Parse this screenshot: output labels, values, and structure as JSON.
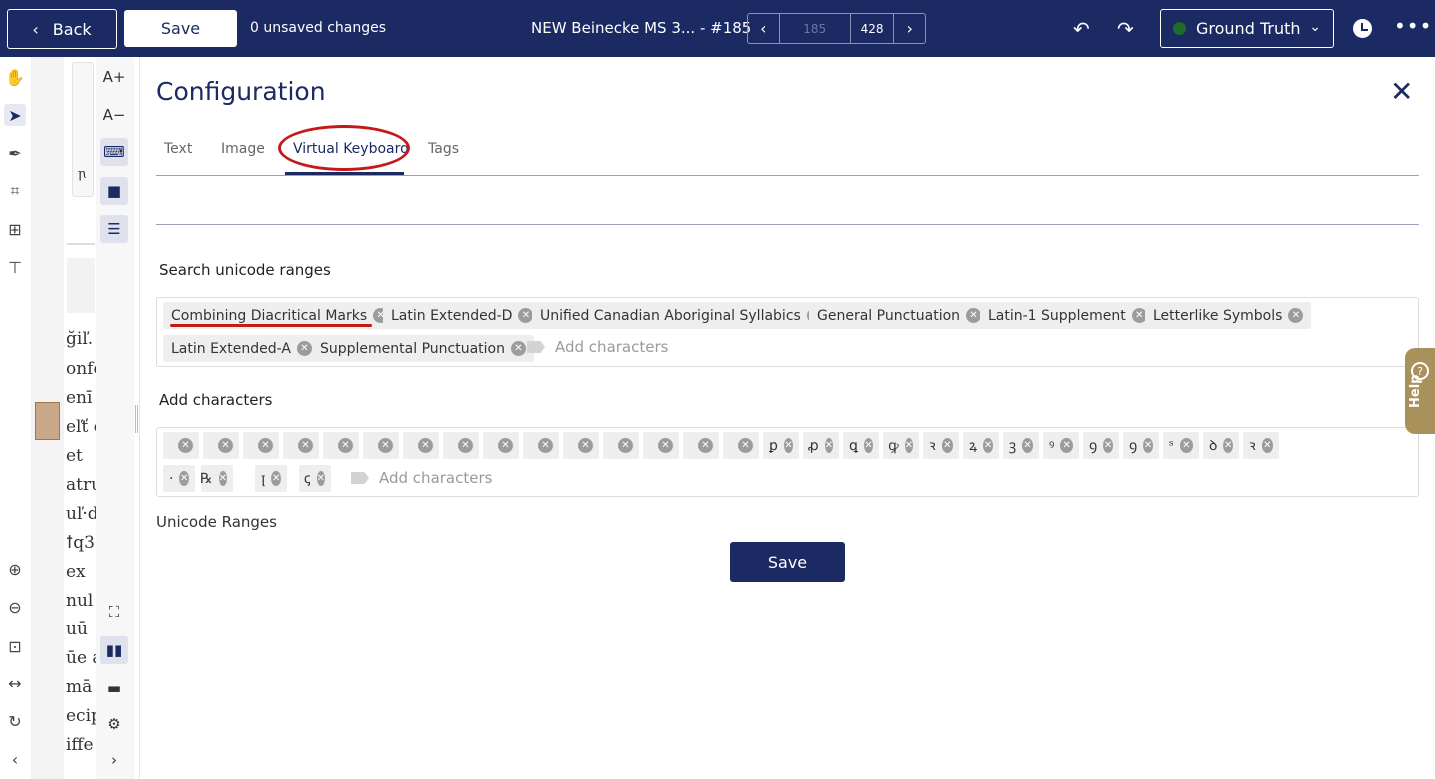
{
  "topbar": {
    "back_label": "Back",
    "save_label": "Save",
    "unsaved_text": "0 unsaved changes",
    "document_title": "NEW Beinecke MS 3... - #185",
    "pager_current": "185",
    "pager_total": "428",
    "transcription_select": "Ground Truth"
  },
  "left_text_fragments": [
    "ğiľ.",
    "onfe",
    "enī",
    "eľť c",
    "et",
    "atru",
    "uľ·ď",
    "ꝉq3",
    "ex",
    "nul",
    "uū",
    "ūe a",
    "mā",
    "ecip",
    "iffe"
  ],
  "mini_glyph": "ꞃ",
  "config": {
    "title": "Configuration",
    "tabs": [
      {
        "label": "Text"
      },
      {
        "label": "Image"
      },
      {
        "label": "Virtual Keyboard"
      },
      {
        "label": "Tags"
      }
    ],
    "active_tab": "Virtual Keyboard",
    "search_ranges_label": "Search unicode ranges",
    "ranges": [
      "Combining Diacritical Marks",
      "Latin Extended-D",
      "Unified Canadian Aboriginal Syllabics",
      "General Punctuation",
      "Latin-1 Supplement",
      "Letterlike Symbols",
      "Latin Extended-A",
      "Supplemental Punctuation"
    ],
    "ranges_placeholder": "Add characters",
    "add_characters_label": "Add characters",
    "characters": [
      "",
      "",
      "",
      "",
      "",
      "",
      "",
      "",
      "",
      "",
      "",
      "",
      "",
      "",
      "",
      "ꝑ",
      "ꝓ",
      "ꝗ",
      "ꝙ",
      "ꝛ",
      "ꝝ",
      "ꝫ",
      "ꝰ",
      "ꝯ",
      "ꝯ",
      "ˢ",
      "ꝺ",
      "ꝛ",
      "·",
      "℞",
      "ꞁ",
      "ꞔ"
    ],
    "characters_placeholder": "Add characters",
    "unicode_ranges_text": "Unicode Ranges",
    "save_label": "Save"
  },
  "help_label": "Help",
  "colors": {
    "brand_navy": "#1b2a63",
    "highlight_red": "#c41a1a",
    "status_green": "#1f6b2a",
    "help_gold": "#a9915c"
  }
}
